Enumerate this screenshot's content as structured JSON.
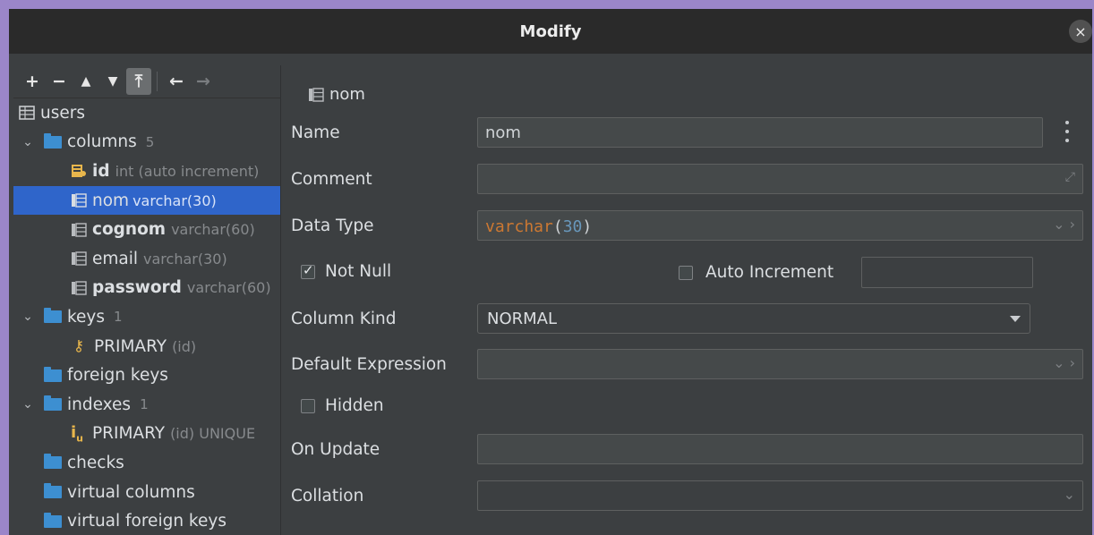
{
  "window": {
    "title": "Modify",
    "close_glyph": "×"
  },
  "toolbar": {
    "add": "+",
    "remove": "−",
    "move_up": "▲",
    "move_down": "▼",
    "pin": "⤒",
    "back": "←",
    "forward": "→"
  },
  "tree": {
    "table": "users",
    "columns_label": "columns",
    "columns_count": "5",
    "cols": [
      {
        "name": "id",
        "type": "int (auto increment)"
      },
      {
        "name": "nom",
        "type": "varchar(30)"
      },
      {
        "name": "cognom",
        "type": "varchar(60)"
      },
      {
        "name": "email",
        "type": "varchar(30)"
      },
      {
        "name": "password",
        "type": "varchar(60)"
      }
    ],
    "keys_label": "keys",
    "keys_count": "1",
    "key_primary": "PRIMARY",
    "key_primary_cols": "(id)",
    "foreign_keys": "foreign keys",
    "indexes_label": "indexes",
    "indexes_count": "1",
    "index_primary": "PRIMARY",
    "index_primary_cols": "(id) UNIQUE",
    "checks": "checks",
    "virtual_columns": "virtual columns",
    "virtual_foreign_keys": "virtual foreign keys"
  },
  "form": {
    "header": "nom",
    "name_label": "Name",
    "name_value": "nom",
    "comment_label": "Comment",
    "comment_value": "",
    "datatype_label": "Data Type",
    "datatype_kw": "varchar",
    "datatype_open": "(",
    "datatype_num": "30",
    "datatype_close": ")",
    "notnull_label": "Not Null",
    "autoinc_label": "Auto Increment",
    "kind_label": "Column Kind",
    "kind_value": "NORMAL",
    "default_label": "Default Expression",
    "hidden_label": "Hidden",
    "onupdate_label": "On Update",
    "collation_label": "Collation"
  },
  "colors": {
    "selection": "#2f65ca",
    "folder": "#3d8fd1",
    "key": "#e8b64c"
  }
}
